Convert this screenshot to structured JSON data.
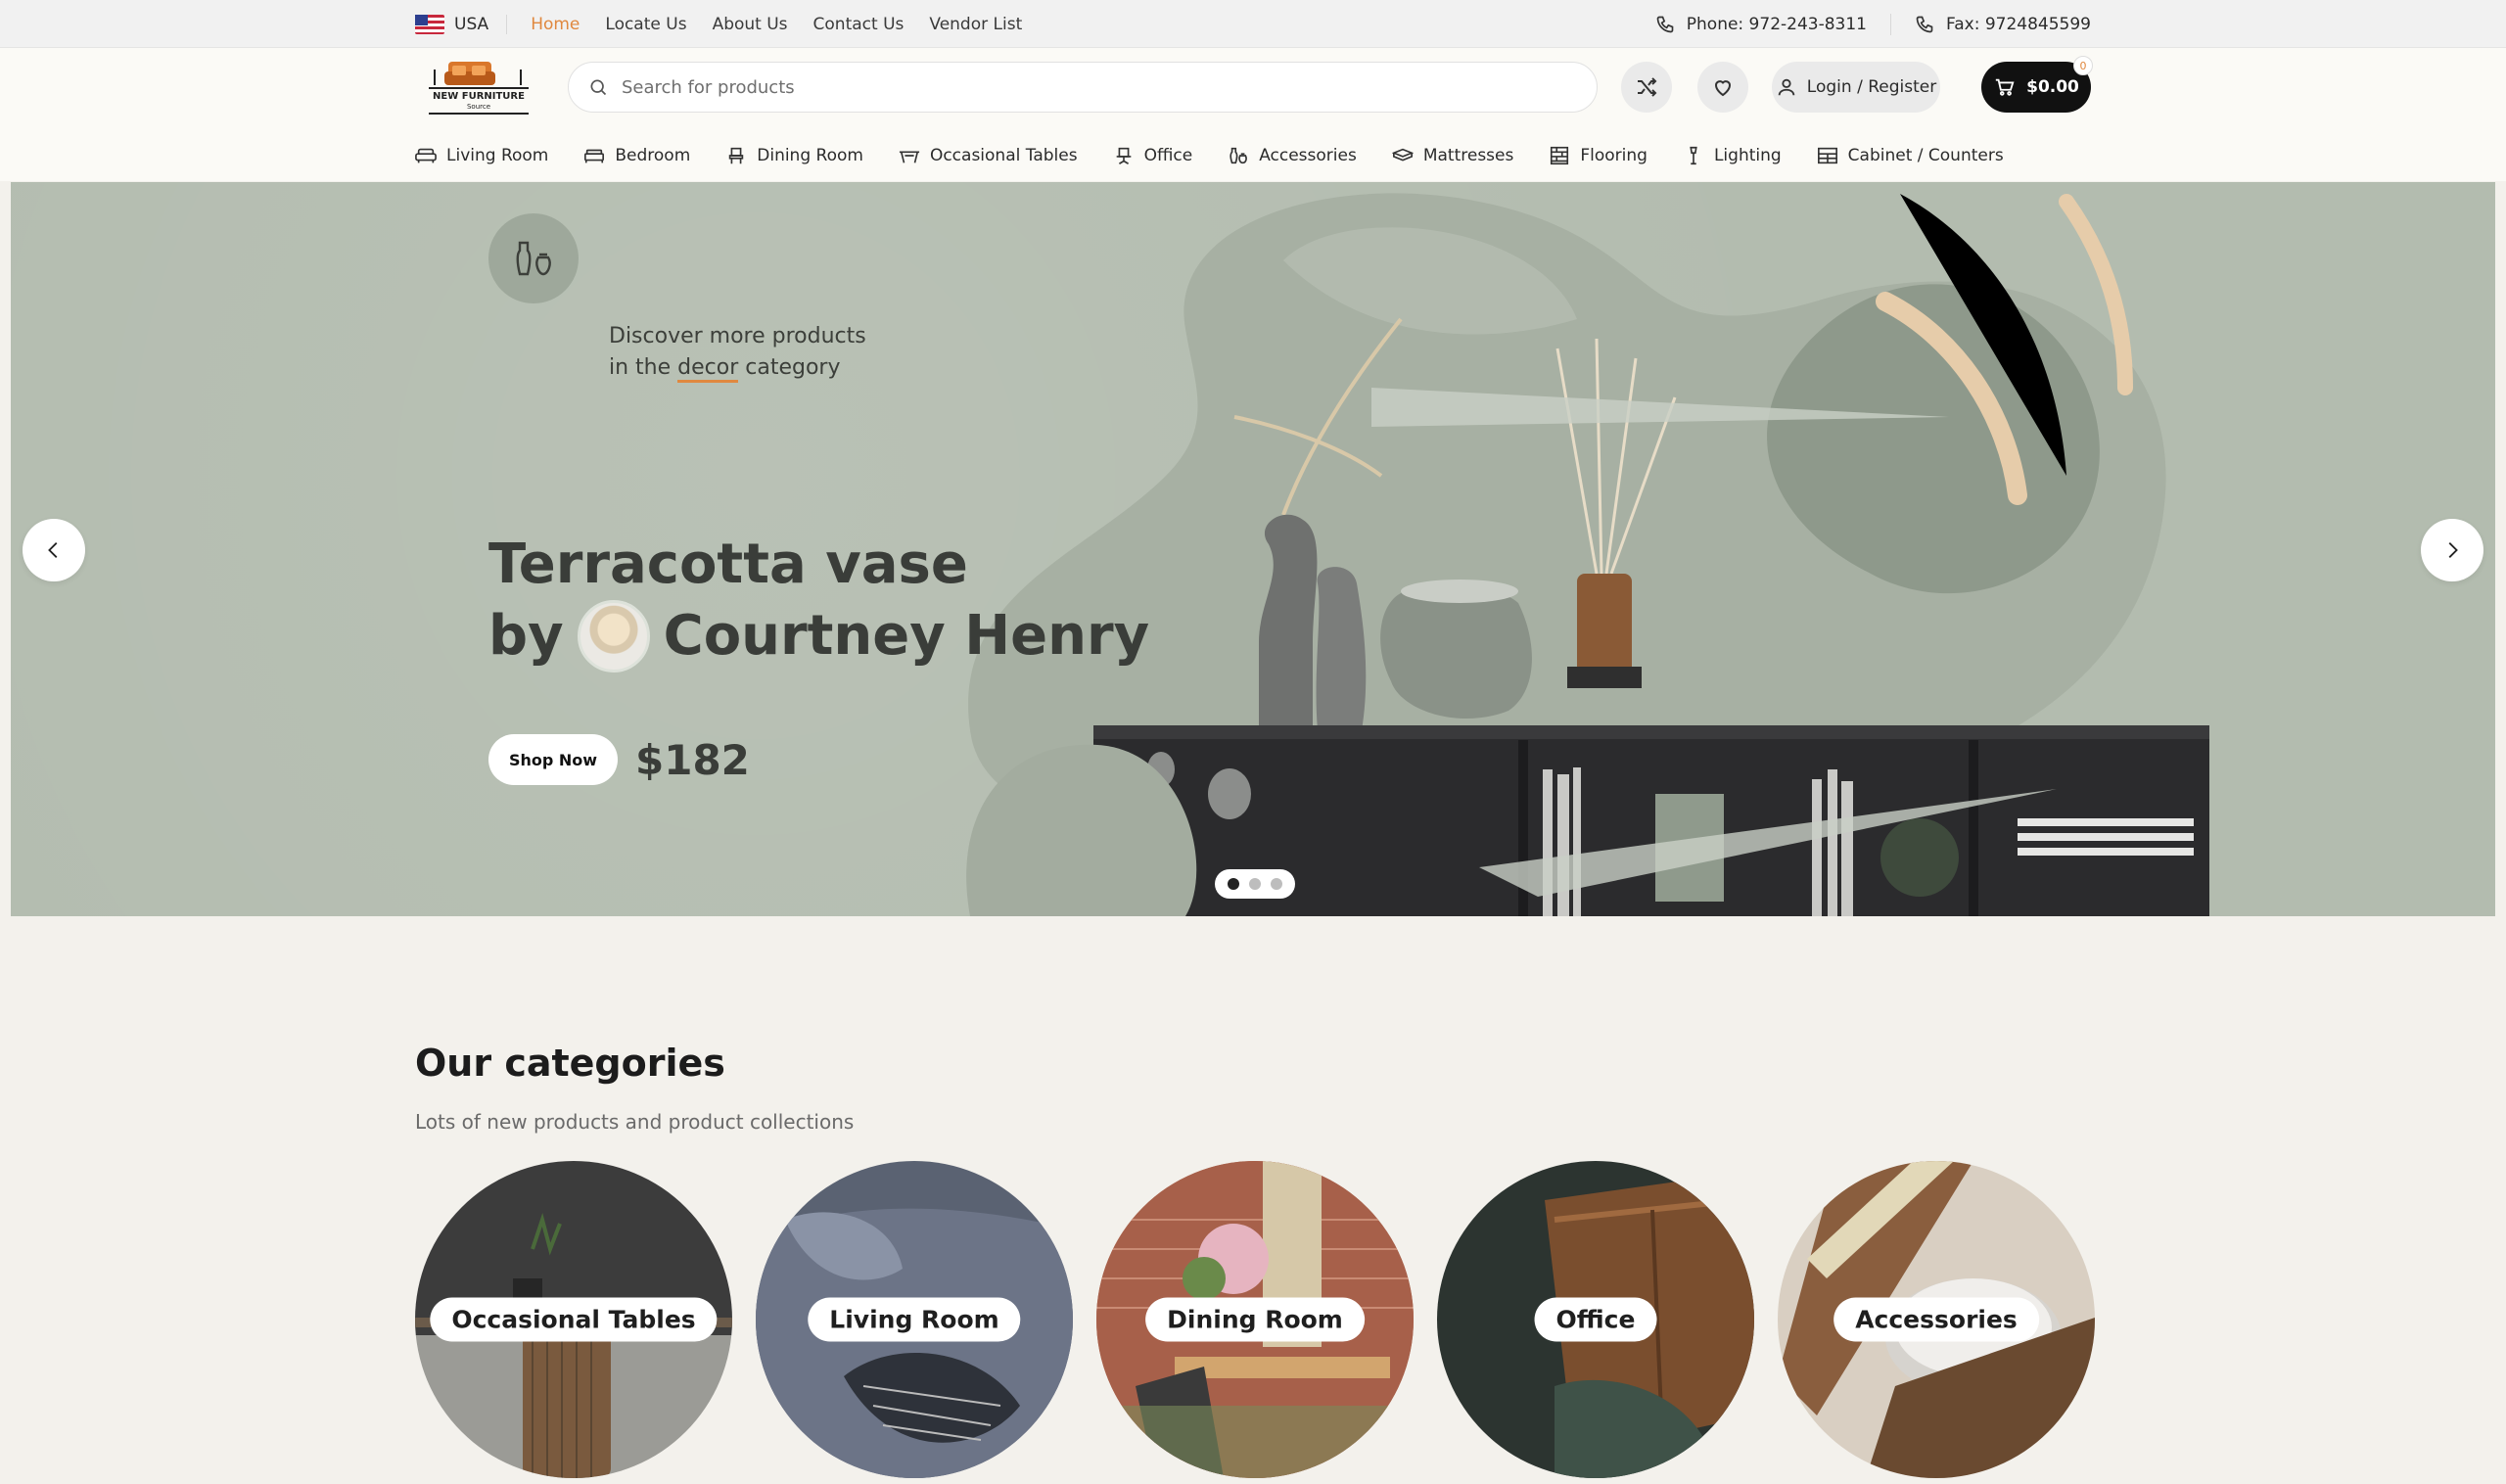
{
  "topbar": {
    "country": "USA",
    "links": [
      "Home",
      "Locate Us",
      "About Us",
      "Contact Us",
      "Vendor List"
    ],
    "phone": "Phone: 972-243-8311",
    "fax": "Fax: 9724845599"
  },
  "header": {
    "logo_text": "NEW FURNITURE",
    "logo_subtext": "Source",
    "search_placeholder": "Search for products",
    "login_label": "Login / Register",
    "cart_total": "$0.00",
    "cart_count": "0"
  },
  "nav": [
    {
      "label": "Living Room",
      "icon": "sofa-icon"
    },
    {
      "label": "Bedroom",
      "icon": "bed-icon"
    },
    {
      "label": "Dining Room",
      "icon": "chair-icon"
    },
    {
      "label": "Occasional Tables",
      "icon": "table-icon"
    },
    {
      "label": "Office",
      "icon": "office-chair-icon"
    },
    {
      "label": "Accessories",
      "icon": "vase-icon"
    },
    {
      "label": "Mattresses",
      "icon": "mattress-icon"
    },
    {
      "label": "Flooring",
      "icon": "flooring-icon"
    },
    {
      "label": "Lighting",
      "icon": "lamp-icon"
    },
    {
      "label": "Cabinet / Counters",
      "icon": "cabinet-icon"
    }
  ],
  "hero": {
    "discover_line1": "Discover more products",
    "discover_line2_pre": "in the ",
    "discover_line2_keyword": "decor",
    "discover_line2_post": " category",
    "title_line1": "Terracotta vase",
    "title_by": "by",
    "title_author": "Courtney Henry",
    "cta": "Shop Now",
    "price": "$182",
    "slides": 3,
    "active_slide": 1
  },
  "categories": {
    "title": "Our categories",
    "subtitle": "Lots of new products and product collections",
    "items": [
      "Occasional Tables",
      "Living Room",
      "Dining Room",
      "Office",
      "Accessories"
    ]
  },
  "colors": {
    "accent": "#e0883f",
    "hero_bg": "#b3bcaf",
    "page_bg": "#f3f1ec",
    "cart_bg": "#111111"
  }
}
